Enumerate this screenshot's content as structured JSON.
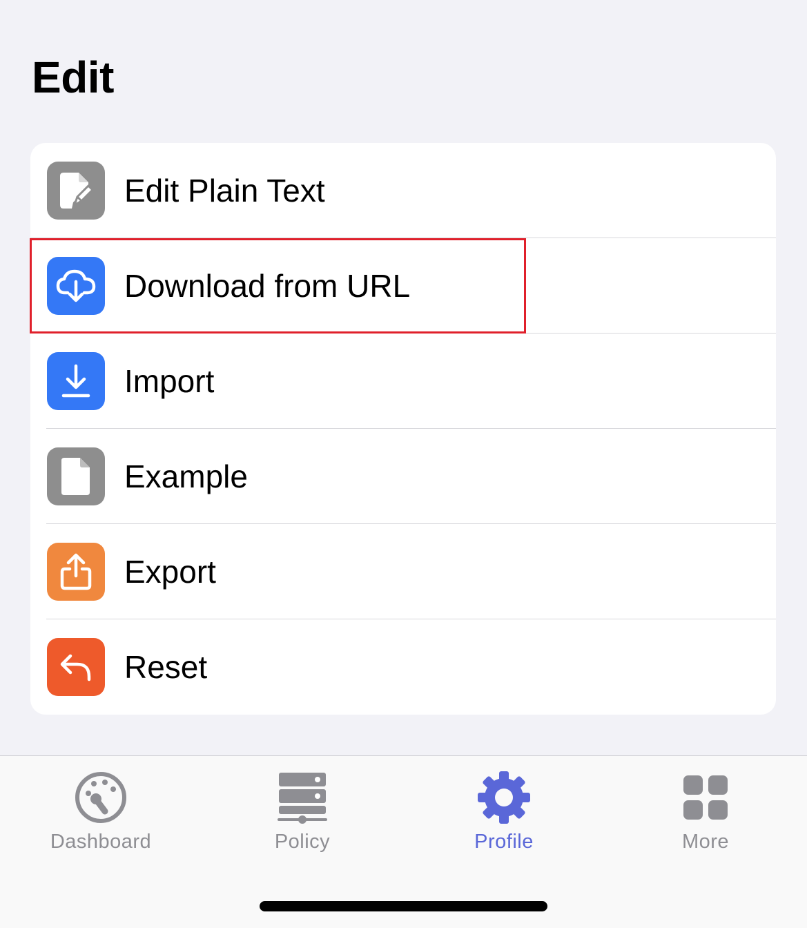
{
  "page": {
    "title": "Edit"
  },
  "menu": {
    "items": [
      {
        "label": "Edit Plain Text",
        "icon": "edit-document-icon",
        "color": "#8e8e8e"
      },
      {
        "label": "Download from URL",
        "icon": "cloud-download-icon",
        "color": "#3478f6"
      },
      {
        "label": "Import",
        "icon": "download-arrow-icon",
        "color": "#3478f6"
      },
      {
        "label": "Example",
        "icon": "document-icon",
        "color": "#8e8e8e"
      },
      {
        "label": "Export",
        "icon": "share-icon",
        "color": "#f0883e"
      },
      {
        "label": "Reset",
        "icon": "undo-arrow-icon",
        "color": "#ee5a2b"
      }
    ],
    "highlighted_item": "Download from URL",
    "highlight_color": "#e0202b"
  },
  "tabbar": {
    "tabs": [
      {
        "label": "Dashboard",
        "icon": "dashboard-gauge-icon",
        "active": false
      },
      {
        "label": "Policy",
        "icon": "server-stack-icon",
        "active": false
      },
      {
        "label": "Profile",
        "icon": "gear-icon",
        "active": true
      },
      {
        "label": "More",
        "icon": "grid-icon",
        "active": false
      }
    ],
    "active_color": "#5a67d8",
    "inactive_color": "#8e8e93"
  }
}
